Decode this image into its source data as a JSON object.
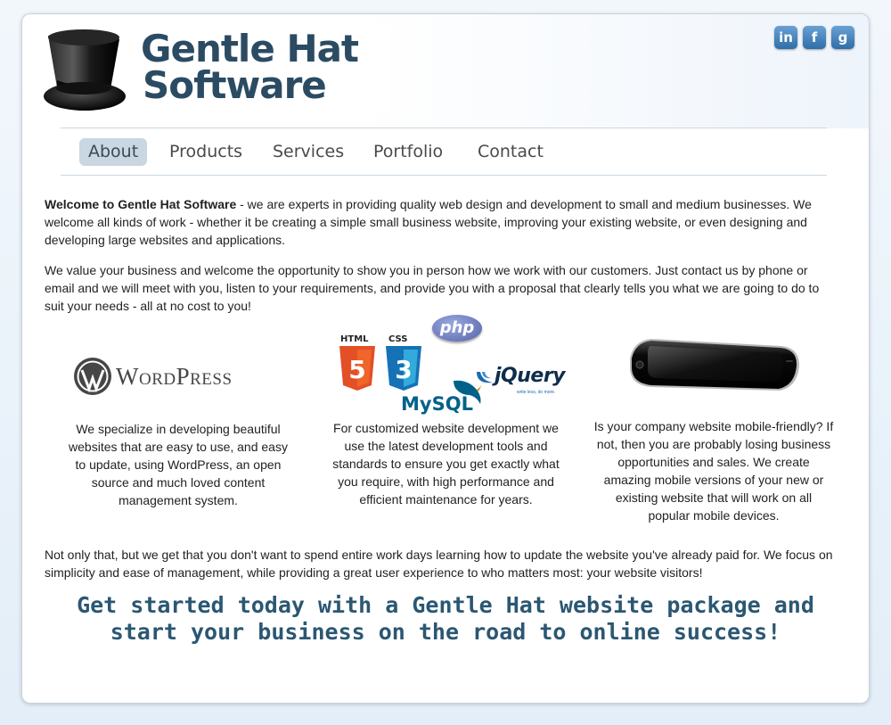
{
  "header": {
    "logo_line1": "Gentle Hat",
    "logo_line2": "Software",
    "social": [
      {
        "name": "linkedin-icon",
        "glyph": "in"
      },
      {
        "name": "facebook-icon",
        "glyph": "f"
      },
      {
        "name": "google-icon",
        "glyph": "g"
      }
    ]
  },
  "nav": {
    "items": [
      "About",
      "Products",
      "Services",
      "Portfolio",
      "Contact"
    ],
    "active": "About"
  },
  "main": {
    "intro_strong": "Welcome to Gentle Hat Software",
    "intro_rest": " - we are experts in providing quality web design and development to small and medium businesses. We welcome all kinds of work - whether it be creating a simple small business website, improving your existing website, or even designing and developing large websites and applications.",
    "value": "We value your business and welcome the opportunity to show you in person how we work with our customers. Just contact us by phone or email and we will meet with you, listen to your requirements, and provide you with a proposal that clearly tells you what we are going to do to suit your needs - all at no cost to you!",
    "col1": "We specialize in developing beautiful websites that are easy to use, and easy to update, using WordPress, an open source and much loved content management system.",
    "col2": "For customized website development we use the latest development tools and standards to ensure you get exactly what you require, with high performance and efficient maintenance for years.",
    "col3": "Is your company website mobile-friendly? If not, then you are probably losing business opportunities and sales. We create amazing mobile versions of your new or existing website that will work on all popular mobile devices.",
    "outro": "Not only that, but we get that you don't want to spend entire work days learning how to update the website you've already paid for. We focus on simplicity and ease of management, while providing a great user experience to who matters most: your website visitors!",
    "cta": "Get started today with a Gentle Hat website package and start your business on the road to online success!"
  },
  "tech_logos": {
    "wordpress": "WordPress",
    "html": "HTML",
    "css": "CSS",
    "php": "php",
    "jquery": "jQuery",
    "jquery_tag": "write less, do more.",
    "mysql": "MySQL"
  },
  "colors": {
    "brand_text": "#2b4b63",
    "nav_active_bg": "#c8d7e2",
    "cta_text": "#2b5772",
    "social_blue": "#2f6ea8"
  }
}
